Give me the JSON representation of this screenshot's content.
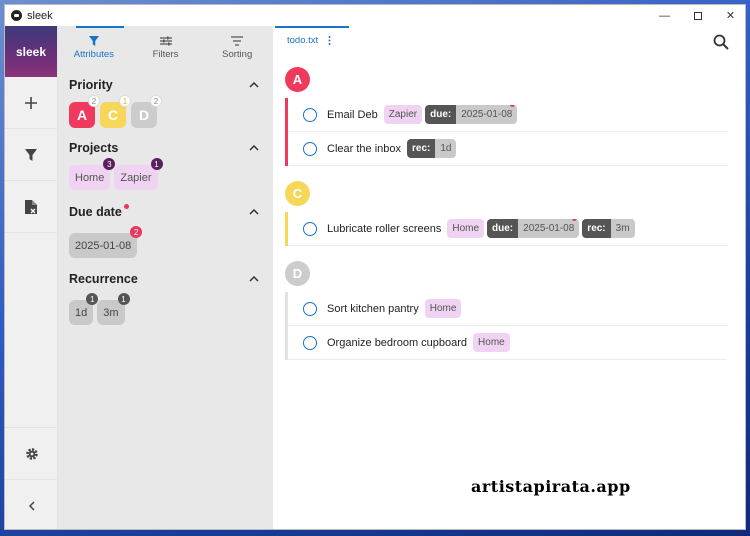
{
  "window": {
    "title": "sleek"
  },
  "rail": {
    "logo": "sleek"
  },
  "panel": {
    "tabs": [
      {
        "label": "Attributes",
        "icon": "filter-icon"
      },
      {
        "label": "Filters",
        "icon": "sliders-icon"
      },
      {
        "label": "Sorting",
        "icon": "sort-icon"
      }
    ],
    "priority": {
      "title": "Priority",
      "chips": [
        {
          "label": "A",
          "count": "2",
          "color": "#ef3a5d"
        },
        {
          "label": "C",
          "count": "1",
          "color": "#f6d75a"
        },
        {
          "label": "D",
          "count": "2",
          "color": "#cccccc"
        }
      ]
    },
    "projects": {
      "title": "Projects",
      "chips": [
        {
          "label": "Home",
          "count": "3"
        },
        {
          "label": "Zapier",
          "count": "1"
        }
      ]
    },
    "due": {
      "title": "Due date",
      "chips": [
        {
          "label": "2025-01-08",
          "count": "2"
        }
      ]
    },
    "recurrence": {
      "title": "Recurrence",
      "chips": [
        {
          "label": "1d",
          "count": "1"
        },
        {
          "label": "3m",
          "count": "1"
        }
      ]
    }
  },
  "main": {
    "file": "todo.txt",
    "groups": [
      {
        "letter": "A",
        "color": "#ef3a5d",
        "items": [
          {
            "text": "Email Deb",
            "project": "Zapier",
            "due_key": "due:",
            "due": "2025-01-08"
          },
          {
            "text": "Clear the inbox",
            "rec_key": "rec:",
            "rec": "1d"
          }
        ]
      },
      {
        "letter": "C",
        "color": "#f6d75a",
        "items": [
          {
            "text": "Lubricate roller screens",
            "project": "Home",
            "due_key": "due:",
            "due": "2025-01-08",
            "rec_key": "rec:",
            "rec": "3m"
          }
        ]
      },
      {
        "letter": "D",
        "color": "#cccccc",
        "items": [
          {
            "text": "Sort kitchen pantry",
            "project": "Home"
          },
          {
            "text": "Organize bedroom cupboard",
            "project": "Home"
          }
        ]
      }
    ]
  },
  "watermark": "artistapirata.app"
}
